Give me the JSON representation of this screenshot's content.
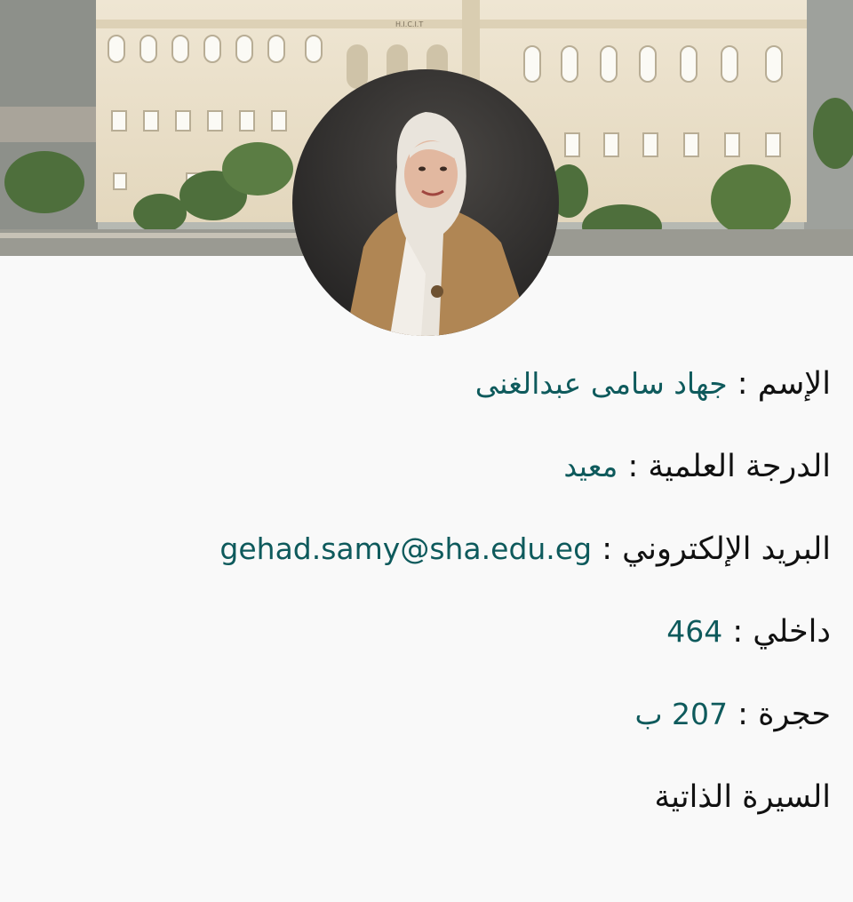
{
  "cover": {
    "building_sign": "H.I.C.I.T"
  },
  "profile": {
    "name_label": "الإسم",
    "name_value": "جهاد سامى عبدالغنى",
    "degree_label": "الدرجة العلمية",
    "degree_value": "معيد",
    "email_label": "البريد الإلكتروني",
    "email_value": "gehad.samy@sha.edu.eg",
    "ext_label": "داخلي",
    "ext_value": "464",
    "room_label": "حجرة",
    "room_value": "207 ب",
    "cv_label": "السيرة الذاتية",
    "separator": ":"
  },
  "colors": {
    "value_accent": "#0e5a5c",
    "label_text": "#111111",
    "page_bg": "#f9f9f9"
  }
}
